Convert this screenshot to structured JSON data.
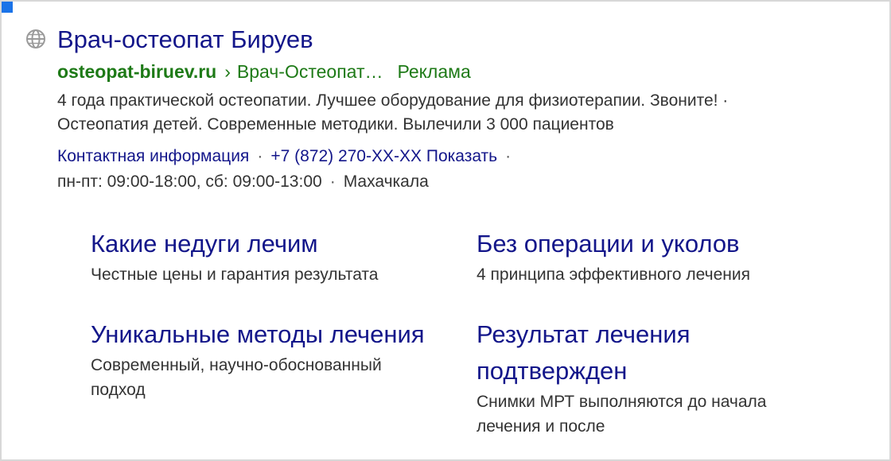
{
  "ad": {
    "favicon_icon": "globe-icon",
    "title": "Врач-остеопат Бируев",
    "domain": "osteopat-biruev.ru",
    "breadcrumb_separator": "›",
    "breadcrumb": "Врач-Остеопат…",
    "ad_label": "Реклама",
    "description_line1": "4 года практической остеопатии. Лучшее оборудование для физиотерапии. Звоните! ·",
    "description_line2": "Остеопатия детей. Современные методики. Вылечили 3 000 пациентов",
    "contacts": {
      "contact_info": "Контактная информация",
      "separator": "·",
      "phone": "+7 (872) 270-XX-XX",
      "show_label": "Показать",
      "hours": "пн-пт: 09:00-18:00, сб: 09:00-13:00",
      "city": "Махачкала"
    }
  },
  "sitelinks": [
    {
      "title": "Какие недуги лечим",
      "description": "Честные цены и гарантия результата"
    },
    {
      "title": "Без операции и уколов",
      "description": "4 принципа эффективного лечения"
    },
    {
      "title": "Уникальные методы лечения",
      "description": "Современный, научно-обоснованный подход"
    },
    {
      "title": "Результат лечения подтвержден",
      "description": "Снимки МРТ выполняются до начала лечения и после"
    }
  ],
  "colors": {
    "title_blue": "#13168a",
    "url_green": "#1e7a17",
    "text_gray": "#333333",
    "corner_accent": "#1a73e8"
  }
}
